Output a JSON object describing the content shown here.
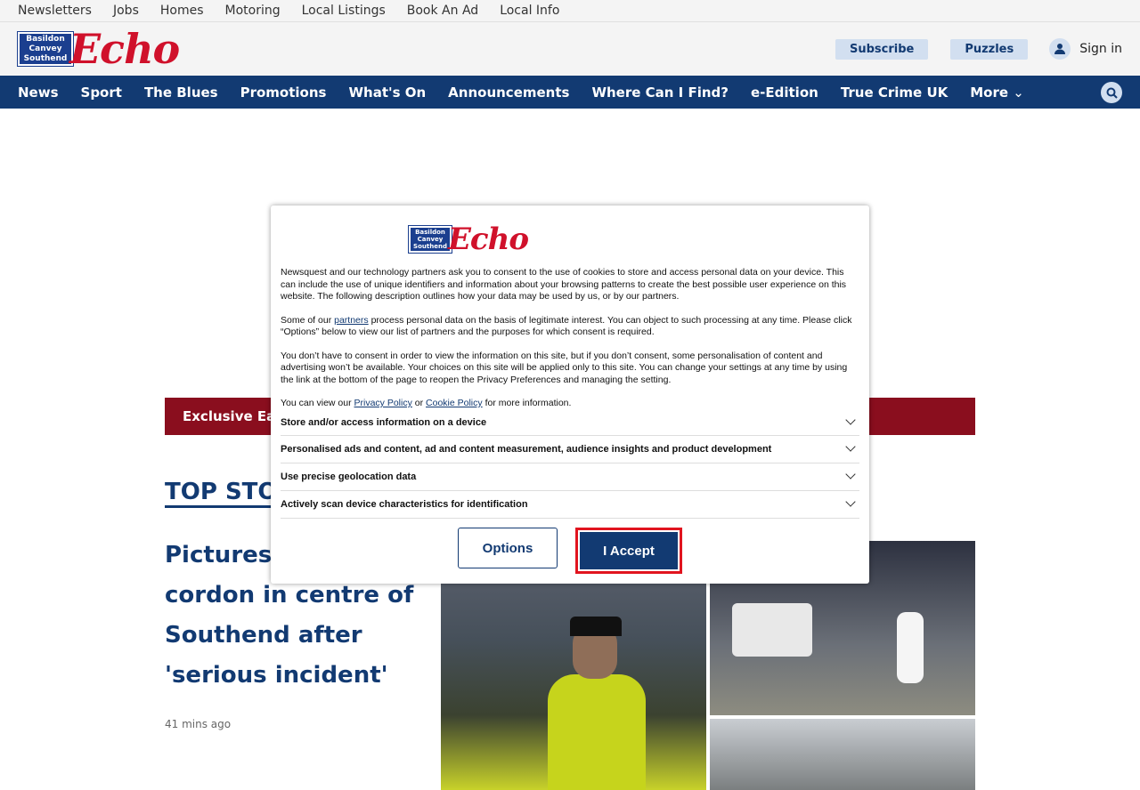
{
  "top_links": [
    "Newsletters",
    "Jobs",
    "Homes",
    "Motoring",
    "Local Listings",
    "Book An Ad",
    "Local Info"
  ],
  "logo": {
    "box_lines": [
      "Basildon",
      "Canvey",
      "Southend"
    ],
    "word": "Echo"
  },
  "header": {
    "subscribe": "Subscribe",
    "puzzles": "Puzzles",
    "signin": "Sign in"
  },
  "nav": [
    "News",
    "Sport",
    "The Blues",
    "Promotions",
    "What's On",
    "Announcements",
    "Where Can I Find?",
    "e-Edition",
    "True Crime UK",
    "More"
  ],
  "banner": "Exclusive Eas",
  "section_title": "TOP STO",
  "article": {
    "headline": "Pictures cordon in centre of Southend after 'serious incident'",
    "headline_visible": "Pictures\ncordon in centre of\nSouthend after\n'serious incident'",
    "time": "41 mins ago"
  },
  "modal": {
    "p1": "Newsquest and our technology partners ask you to consent to the use of cookies to store and access personal data on your device. This can include the use of unique identifiers and information about your browsing patterns to create the best possible user experience on this website. The following description outlines how your data may be used by us, or by our partners.",
    "p2_pre": "Some of our ",
    "p2_link": "partners",
    "p2_post": " process personal data on the basis of legitimate interest. You can object to such processing at any time. Please click “Options” below to view our list of partners and the purposes for which consent is required.",
    "p3": "You don’t have to consent in order to view the information on this site, but if you don’t consent, some personalisation of content and advertising won’t be available. Your choices on this site will be applied only to this site. You can change your settings at any time by using the link at the bottom of the page to reopen the Privacy Preferences and managing the setting.",
    "p4_pre": "You can view our ",
    "privacy_link": "Privacy Policy",
    "p4_mid": " or ",
    "cookie_link": "Cookie Policy",
    "p4_post": " for more information.",
    "purposes": [
      "Store and/or access information on a device",
      "Personalised ads and content, ad and content measurement, audience insights and product development",
      "Use precise geolocation data",
      "Actively scan device characteristics for identification"
    ],
    "options_label": "Options",
    "accept_label": "I Accept"
  }
}
